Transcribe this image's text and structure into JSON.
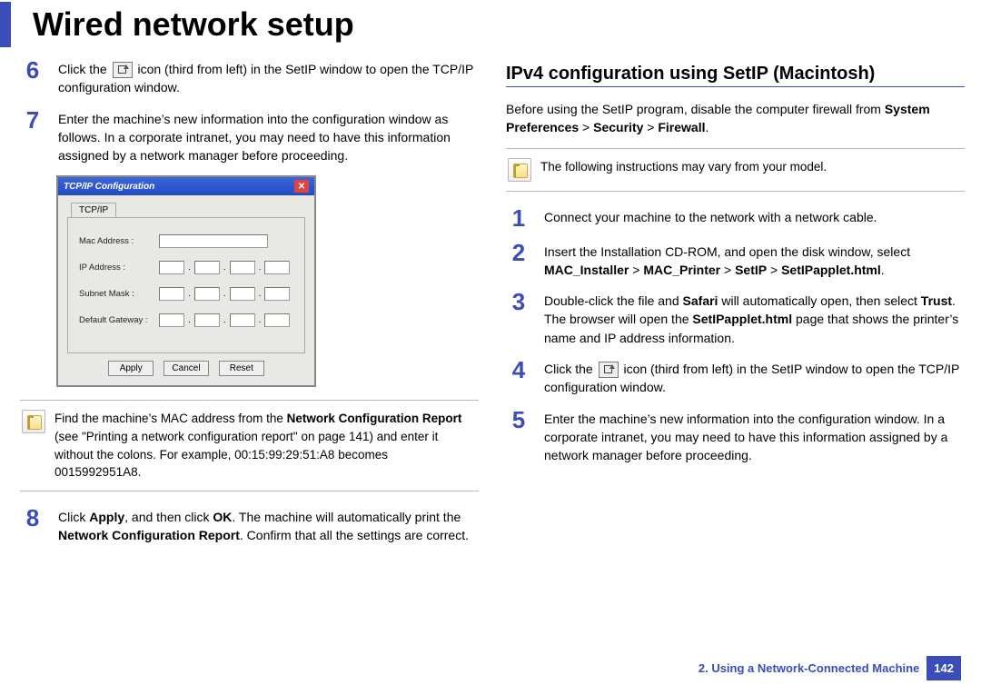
{
  "page_title": "Wired network setup",
  "left": {
    "steps": {
      "6": {
        "num": "6",
        "a": "Click the",
        "b": "icon (third from left) in the SetIP window to open the TCP/IP configuration window."
      },
      "7": {
        "num": "7",
        "text": "Enter the machine’s new information into the configuration window as follows. In a corporate intranet, you may need to have this information assigned by a network manager before proceeding."
      },
      "8": {
        "num": "8",
        "a": "Click ",
        "b_bold": "Apply",
        "c": ", and then click ",
        "d_bold": "OK",
        "e": ". The machine will automatically print the ",
        "f_bold": "Network Configuration Report",
        "g": ". Confirm that all the settings are correct."
      }
    },
    "dialog": {
      "title": "TCP/IP Configuration",
      "tab": "TCP/IP",
      "fields": {
        "mac": "Mac Address :",
        "ip": "IP Address :",
        "subnet": "Subnet Mask :",
        "gateway": "Default Gateway :"
      },
      "buttons": {
        "apply": "Apply",
        "cancel": "Cancel",
        "reset": "Reset"
      }
    },
    "note": {
      "a": "Find the machine’s MAC address from the ",
      "b_bold": "Network Configuration Report",
      "c": " (see \"Printing a network configuration report\" on page 141) and enter it without the colons. For example, 00:15:99:29:51:A8 becomes 0015992951A8."
    }
  },
  "right": {
    "heading": "IPv4 configuration using SetIP (Macintosh)",
    "intro": {
      "a": "Before using the SetIP program, disable the computer firewall from ",
      "b_bold": "System Preferences",
      "c": " > ",
      "d_bold": "Security",
      "e": " > ",
      "f_bold": "Firewall",
      "g": "."
    },
    "note": "The following instructions may vary from your model.",
    "steps": {
      "1": {
        "num": "1",
        "text": "Connect your machine to the network with a network cable."
      },
      "2": {
        "num": "2",
        "a": "Insert the Installation CD-ROM, and open the disk window, select ",
        "b_bold": "MAC_Installer",
        "c": " > ",
        "d_bold": "MAC_Printer",
        "e": " > ",
        "f_bold": "SetIP",
        "g": " > ",
        "h_bold": "SetIPapplet.html",
        "i": "."
      },
      "3": {
        "num": "3",
        "a": "Double-click the file and ",
        "b_bold": "Safari",
        "c": " will automatically open, then select ",
        "d_bold": "Trust",
        "e": ". The browser will open the ",
        "f_bold": "SetIPapplet.html",
        "g": " page that shows the printer’s name and IP address information."
      },
      "4": {
        "num": "4",
        "a": "Click the",
        "b": "icon (third from left) in the SetIP window to open the TCP/IP configuration window."
      },
      "5": {
        "num": "5",
        "text": "Enter the machine’s new information into the configuration window. In a corporate intranet, you may need to have this information assigned by a network manager before proceeding."
      }
    }
  },
  "footer": {
    "chapter": "2.  Using a Network-Connected Machine",
    "page": "142"
  }
}
